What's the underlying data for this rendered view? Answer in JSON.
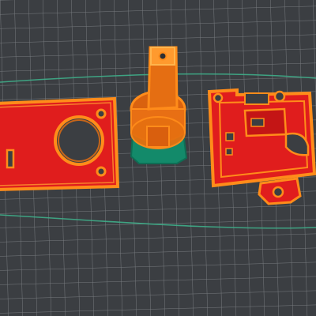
{
  "scene": {
    "background_color": "#3b3e42",
    "grid_color": "#8a8e93",
    "travel_line_color": "#3fae8a",
    "wall_color": "#ff8c1a",
    "infill_color": "#d81b1b",
    "support_color": "#138a6a",
    "objects": [
      {
        "name": "rectangular-plate-with-round-hole",
        "icon": "plate-shape"
      },
      {
        "name": "cylindrical-knob-part",
        "icon": "cylinder-shape"
      },
      {
        "name": "bracket-with-mounting-tab",
        "icon": "bracket-shape"
      }
    ]
  }
}
